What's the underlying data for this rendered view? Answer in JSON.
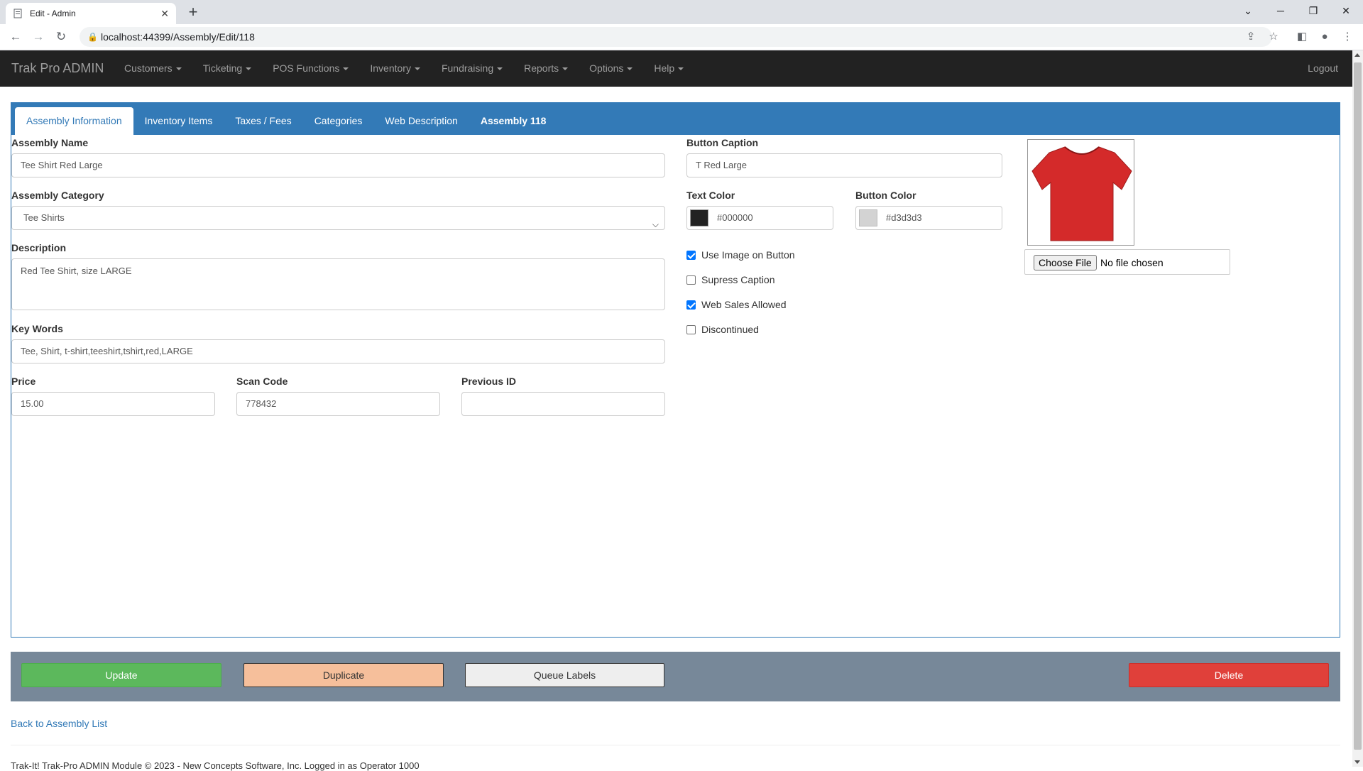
{
  "browser": {
    "tab_title": "Edit - Admin",
    "url": "localhost:44399/Assembly/Edit/118"
  },
  "navbar": {
    "brand": "Trak Pro ADMIN",
    "menu": [
      "Customers",
      "Ticketing",
      "POS Functions",
      "Inventory",
      "Fundraising",
      "Reports",
      "Options",
      "Help"
    ],
    "logout": "Logout"
  },
  "tabs": [
    "Assembly Information",
    "Inventory Items",
    "Taxes / Fees",
    "Categories",
    "Web Description",
    "Assembly 118"
  ],
  "form": {
    "assembly_name_label": "Assembly Name",
    "assembly_name": "Tee Shirt Red Large",
    "category_label": "Assembly Category",
    "category": "Tee Shirts",
    "description_label": "Description",
    "description": "Red Tee Shirt, size LARGE",
    "keywords_label": "Key Words",
    "keywords": "Tee, Shirt, t-shirt,teeshirt,tshirt,red,LARGE",
    "price_label": "Price",
    "price": "15.00",
    "scan_code_label": "Scan Code",
    "scan_code": "778432",
    "previous_id_label": "Previous ID",
    "previous_id": "",
    "button_caption_label": "Button Caption",
    "button_caption": "T Red Large",
    "text_color_label": "Text Color",
    "text_color": "#000000",
    "button_color_label": "Button Color",
    "button_color": "#d3d3d3",
    "checkboxes": [
      {
        "label": "Use Image on Button",
        "checked": true
      },
      {
        "label": "Supress Caption",
        "checked": false
      },
      {
        "label": "Web Sales Allowed",
        "checked": true
      },
      {
        "label": "Discontinued",
        "checked": false
      }
    ],
    "choose_file": "Choose File",
    "no_file": "No file chosen"
  },
  "actions": {
    "update": "Update",
    "duplicate": "Duplicate",
    "queue_labels": "Queue Labels",
    "delete": "Delete"
  },
  "back_link": "Back to Assembly List",
  "footer": "Trak-It! Trak-Pro ADMIN Module © 2023 - New Concepts Software, Inc.          Logged in as Operator 1000",
  "colors": {
    "accent": "#337ab7",
    "navbar": "#222222",
    "toolbar": "#778899",
    "update": "#5cb85c",
    "duplicate": "#f6bf9b",
    "delete": "#e0403a",
    "shirt": "#d42a2a"
  }
}
